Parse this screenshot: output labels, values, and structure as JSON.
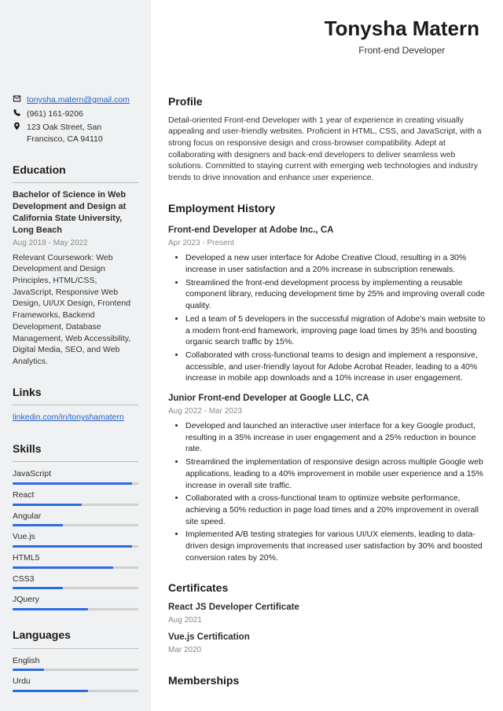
{
  "header": {
    "name": "Tonysha Matern",
    "title": "Front-end Developer"
  },
  "contact": {
    "email": "tonysha.matern@gmail.com",
    "phone": "(961) 161-9206",
    "address": "123 Oak Street, San Francisco, CA 94110"
  },
  "sections": {
    "education": "Education",
    "links": "Links",
    "skills": "Skills",
    "languages": "Languages",
    "profile": "Profile",
    "employment": "Employment History",
    "certificates": "Certificates",
    "memberships": "Memberships"
  },
  "education": {
    "degree": "Bachelor of Science in Web Development and Design at California State University, Long Beach",
    "dates": "Aug 2018 - May 2022",
    "coursework": "Relevant Coursework: Web Development and Design Principles, HTML/CSS, JavaScript, Responsive Web Design, UI/UX Design, Frontend Frameworks, Backend Development, Database Management, Web Accessibility, Digital Media, SEO, and Web Analytics."
  },
  "links": {
    "linkedin": "linkedin.com/in/tonyshamatern"
  },
  "skills": [
    {
      "name": "JavaScript",
      "level": 95
    },
    {
      "name": "React",
      "level": 55
    },
    {
      "name": "Angular",
      "level": 40
    },
    {
      "name": "Vue.js",
      "level": 95
    },
    {
      "name": "HTML5",
      "level": 80
    },
    {
      "name": "CSS3",
      "level": 40
    },
    {
      "name": "JQuery",
      "level": 60
    }
  ],
  "languages": [
    {
      "name": "English",
      "level": 25
    },
    {
      "name": "Urdu",
      "level": 60
    }
  ],
  "profile": "Detail-oriented Front-end Developer with 1 year of experience in creating visually appealing and user-friendly websites. Proficient in HTML, CSS, and JavaScript, with a strong focus on responsive design and cross-browser compatibility. Adept at collaborating with designers and back-end developers to deliver seamless web solutions. Committed to staying current with emerging web technologies and industry trends to drive innovation and enhance user experience.",
  "jobs": [
    {
      "title": "Front-end Developer at Adobe Inc., CA",
      "dates": "Apr 2023 - Present",
      "bullets": [
        "Developed a new user interface for Adobe Creative Cloud, resulting in a 30% increase in user satisfaction and a 20% increase in subscription renewals.",
        "Streamlined the front-end development process by implementing a reusable component library, reducing development time by 25% and improving overall code quality.",
        "Led a team of 5 developers in the successful migration of Adobe's main website to a modern front-end framework, improving page load times by 35% and boosting organic search traffic by 15%.",
        "Collaborated with cross-functional teams to design and implement a responsive, accessible, and user-friendly layout for Adobe Acrobat Reader, leading to a 40% increase in mobile app downloads and a 10% increase in user engagement."
      ]
    },
    {
      "title": "Junior Front-end Developer at Google LLC, CA",
      "dates": "Aug 2022 - Mar 2023",
      "bullets": [
        "Developed and launched an interactive user interface for a key Google product, resulting in a 35% increase in user engagement and a 25% reduction in bounce rate.",
        "Streamlined the implementation of responsive design across multiple Google web applications, leading to a 40% improvement in mobile user experience and a 15% increase in overall site traffic.",
        "Collaborated with a cross-functional team to optimize website performance, achieving a 50% reduction in page load times and a 20% improvement in overall site speed.",
        "Implemented A/B testing strategies for various UI/UX elements, leading to data-driven design improvements that increased user satisfaction by 30% and boosted conversion rates by 20%."
      ]
    }
  ],
  "certificates": [
    {
      "name": "React JS Developer Certificate",
      "date": "Aug 2021"
    },
    {
      "name": "Vue.js Certification",
      "date": "Mar 2020"
    }
  ]
}
